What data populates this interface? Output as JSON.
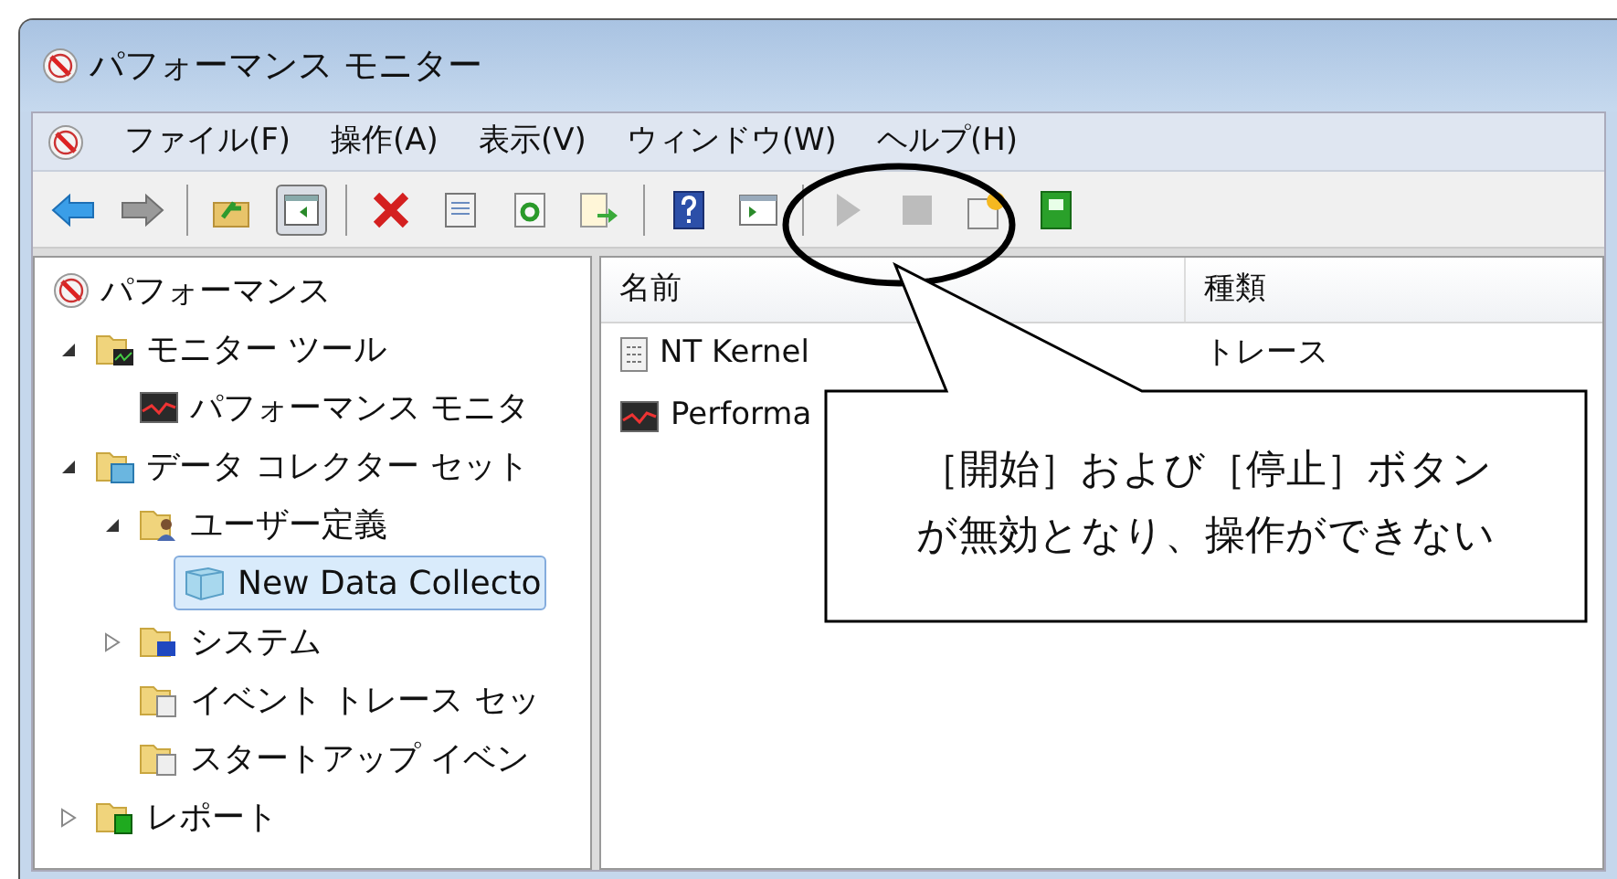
{
  "window": {
    "title": "パフォーマンス モニター"
  },
  "menu": [
    "ファイル(F)",
    "操作(A)",
    "表示(V)",
    "ウィンドウ(W)",
    "ヘルプ(H)"
  ],
  "toolbar": [
    {
      "kind": "back",
      "disabled": false
    },
    {
      "kind": "forward",
      "disabled": false
    },
    {
      "kind": "sep"
    },
    {
      "kind": "up",
      "disabled": false
    },
    {
      "kind": "pane",
      "disabled": false,
      "selected": true
    },
    {
      "kind": "sep"
    },
    {
      "kind": "delete",
      "disabled": false
    },
    {
      "kind": "properties",
      "disabled": false
    },
    {
      "kind": "refresh",
      "disabled": false
    },
    {
      "kind": "export",
      "disabled": false
    },
    {
      "kind": "sep"
    },
    {
      "kind": "help",
      "disabled": false
    },
    {
      "kind": "view",
      "disabled": false
    },
    {
      "kind": "sep"
    },
    {
      "kind": "start",
      "disabled": true
    },
    {
      "kind": "stop",
      "disabled": true
    },
    {
      "kind": "new",
      "disabled": false
    },
    {
      "kind": "report",
      "disabled": false
    }
  ],
  "tree": {
    "label": "パフォーマンス",
    "kind": "perf",
    "children": [
      {
        "label": "モニター ツール",
        "kind": "folder-monitor",
        "expanded": true,
        "selected": false,
        "children": [
          {
            "label": "パフォーマンス モニタ",
            "kind": "graph",
            "selected": false
          }
        ]
      },
      {
        "label": "データ コレクター セット",
        "kind": "folder-data",
        "expanded": true,
        "selected": false,
        "children": [
          {
            "label": "ユーザー定義",
            "kind": "folder-user",
            "expanded": true,
            "selected": false,
            "children": [
              {
                "label": "New Data Collecto",
                "kind": "cube",
                "selected": true
              }
            ]
          },
          {
            "label": "システム",
            "kind": "folder-system",
            "expanded": false,
            "selected": false
          },
          {
            "label": "イベント トレース セッ",
            "kind": "folder-trace",
            "selected": false
          },
          {
            "label": "スタートアップ イベン",
            "kind": "folder-trace",
            "selected": false
          }
        ]
      },
      {
        "label": "レポート",
        "kind": "folder-report",
        "expanded": false,
        "selected": false
      }
    ]
  },
  "list": {
    "columns": [
      "名前",
      "種類"
    ],
    "rows": [
      {
        "kind": "trace",
        "cells": [
          "NT Kernel",
          "トレース"
        ]
      },
      {
        "kind": "graph",
        "cells": [
          "Performa"
        ]
      }
    ]
  },
  "callout": {
    "text": "［開始］および［停止］ボタンが無効となり、操作ができない"
  }
}
